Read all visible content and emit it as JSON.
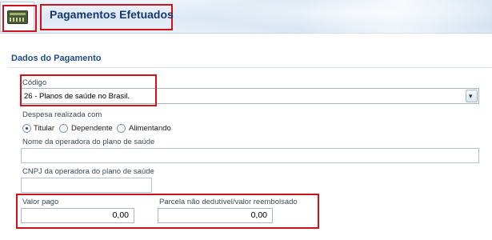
{
  "header": {
    "title": "Pagamentos Efetuados",
    "icon": "credit-card-icon"
  },
  "section": {
    "title": "Dados do Pagamento"
  },
  "codigo": {
    "label": "Código",
    "value": "26 - Planos de saúde no Brasil.",
    "dropdown_icon": "chevron-down-icon"
  },
  "despesa": {
    "label": "Despesa realizada com",
    "options": [
      "Titular",
      "Dependente",
      "Alimentando"
    ],
    "selected": "Titular"
  },
  "operadora_nome": {
    "label": "Nome da operadora do plano de saúde",
    "value": ""
  },
  "operadora_cnpj": {
    "label": "CNPJ da operadora do plano de saúde",
    "value": ""
  },
  "valor_pago": {
    "label": "Valor pago",
    "value": "0,00"
  },
  "parcela": {
    "label": "Parcela não dedutível/valor reembolsado",
    "value": "0,00"
  },
  "colors": {
    "highlight": "#d0131a",
    "title": "#16386b",
    "section_title": "#1f4e86"
  }
}
